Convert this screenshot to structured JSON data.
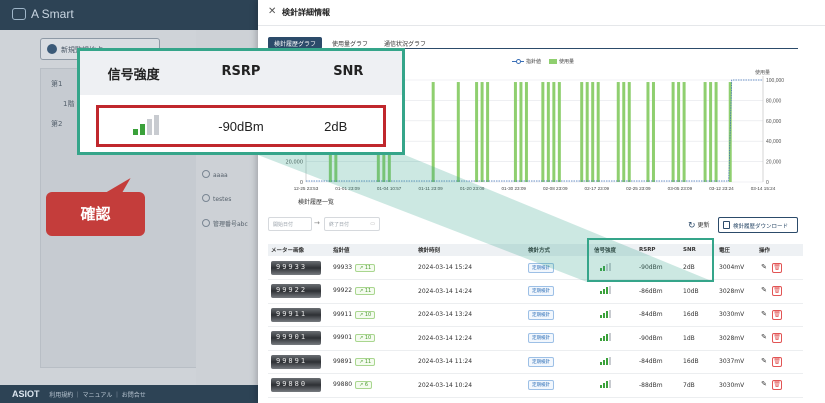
{
  "background": {
    "logo": "A Smart",
    "new_button": "新規監視地点",
    "rows": [
      "第1",
      "1階",
      "第2"
    ],
    "mid_items": [
      "aaaa",
      "testes",
      "管理番号abc"
    ],
    "footer_logo": "ASIOT",
    "footer_links": [
      "利用規約",
      "マニュアル",
      "お問合せ"
    ]
  },
  "drawer": {
    "title": "検針詳細情報",
    "tabs": [
      "検針履歴グラフ",
      "使用量グラフ",
      "通信状況グラフ"
    ],
    "active_tab": 0
  },
  "chart_data": {
    "type": "bar",
    "legend": [
      "指針値",
      "使用量"
    ],
    "x_ticks": [
      "12-25 23:53",
      "01-01 23:09",
      "01-04 10:57",
      "01-11 23:09",
      "01-20 23:09",
      "01-30 23:09",
      "02-08 23:09",
      "02-17 23:09",
      "02-25 23:09",
      "03-05 23:09",
      "03-12 23:24",
      "03-14 15:24"
    ],
    "y_left_ticks": [
      "0",
      "20,000"
    ],
    "y_right_label": "使用量",
    "y_right_ticks": [
      "0",
      "20,000",
      "40,000",
      "60,000",
      "80,000",
      "100,000"
    ],
    "ylim": [
      0,
      100000
    ],
    "bar_groups": [
      {
        "start": 0.05,
        "count": 2,
        "value": 98000
      },
      {
        "start": 0.155,
        "count": 3,
        "value": 98000
      },
      {
        "start": 0.275,
        "count": 1,
        "value": 98000
      },
      {
        "start": 0.33,
        "count": 1,
        "value": 98000
      },
      {
        "start": 0.37,
        "count": 3,
        "value": 98000
      },
      {
        "start": 0.455,
        "count": 3,
        "value": 98000
      },
      {
        "start": 0.515,
        "count": 4,
        "value": 98000
      },
      {
        "start": 0.6,
        "count": 4,
        "value": 98000
      },
      {
        "start": 0.68,
        "count": 3,
        "value": 98000
      },
      {
        "start": 0.745,
        "count": 2,
        "value": 98000
      },
      {
        "start": 0.8,
        "count": 3,
        "value": 98000
      },
      {
        "start": 0.87,
        "count": 3,
        "value": 98000
      },
      {
        "start": 0.925,
        "count": 1,
        "value": 98000
      }
    ],
    "line_start_fraction": 0.925,
    "line_value": 100000
  },
  "history": {
    "title": "検針履歴一覧",
    "start_placeholder": "開始日付",
    "end_placeholder": "終了日付",
    "refresh_label": "更新",
    "download_label": "検針履歴ダウンロード",
    "columns": [
      "メーター画像",
      "指針値",
      "検針時刻",
      "検針方式",
      "信号強度",
      "RSRP",
      "SNR",
      "電圧",
      "操作"
    ],
    "rows": [
      {
        "meter": "99933",
        "value": "99933",
        "diff": "11",
        "time": "2024-03-14 15:24",
        "method": "定期検針",
        "signal": 2,
        "rsrp": "-90dBm",
        "snr": "2dB",
        "voltage": "3004mV"
      },
      {
        "meter": "99922",
        "value": "99922",
        "diff": "11",
        "time": "2024-03-14 14:24",
        "method": "定期検針",
        "signal": 3,
        "rsrp": "-86dBm",
        "snr": "10dB",
        "voltage": "3028mV"
      },
      {
        "meter": "99911",
        "value": "99911",
        "diff": "10",
        "time": "2024-03-14 13:24",
        "method": "定期検針",
        "signal": 3,
        "rsrp": "-84dBm",
        "snr": "16dB",
        "voltage": "3030mV"
      },
      {
        "meter": "99901",
        "value": "99901",
        "diff": "10",
        "time": "2024-03-14 12:24",
        "method": "定期検針",
        "signal": 3,
        "rsrp": "-90dBm",
        "snr": "1dB",
        "voltage": "3028mV"
      },
      {
        "meter": "99891",
        "value": "99891",
        "diff": "11",
        "time": "2024-03-14 11:24",
        "method": "定期検針",
        "signal": 3,
        "rsrp": "-84dBm",
        "snr": "16dB",
        "voltage": "3037mV"
      },
      {
        "meter": "99880",
        "value": "99880",
        "diff": "6",
        "time": "2024-03-14 10:24",
        "method": "定期検針",
        "signal": 3,
        "rsrp": "-88dBm",
        "snr": "7dB",
        "voltage": "3030mV"
      }
    ]
  },
  "zoom": {
    "headers": [
      "信号強度",
      "RSRP",
      "SNR"
    ],
    "signal": 2,
    "rsrp": "-90dBm",
    "snr": "2dB"
  },
  "callout": {
    "label": "確認"
  },
  "colors": {
    "accent": "#35a58a",
    "highlight": "#c0272d",
    "callout": "#c43d3b",
    "bar": "#8fcf6f",
    "line": "#3b6fb6",
    "nav": "#2c4b6a"
  }
}
